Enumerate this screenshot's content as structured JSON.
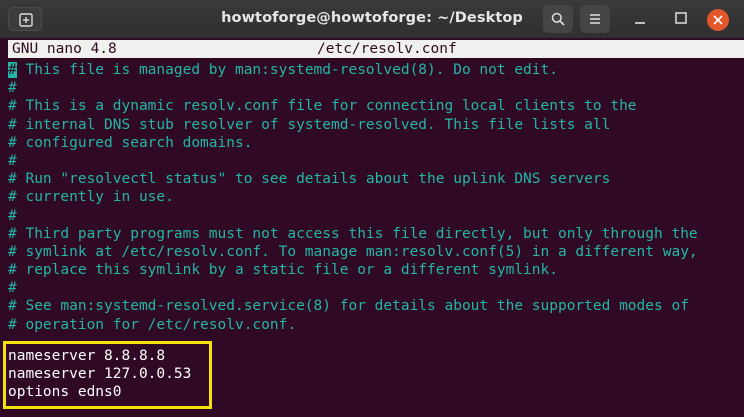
{
  "window": {
    "title": "howtoforge@howtoforge: ~/Desktop"
  },
  "icons": {
    "new_tab": "new-tab-icon",
    "search": "search-icon",
    "menu": "hamburger-menu-icon",
    "minimize": "minimize-icon",
    "maximize": "maximize-icon",
    "close": "close-icon"
  },
  "nano": {
    "version": "GNU nano 4.8",
    "filename": "/etc/resolv.conf"
  },
  "comment_lines": [
    "# This file is managed by man:systemd-resolved(8). Do not edit.",
    "#",
    "# This is a dynamic resolv.conf file for connecting local clients to the",
    "# internal DNS stub resolver of systemd-resolved. This file lists all",
    "# configured search domains.",
    "#",
    "# Run \"resolvectl status\" to see details about the uplink DNS servers",
    "# currently in use.",
    "#",
    "# Third party programs must not access this file directly, but only through the",
    "# symlink at /etc/resolv.conf. To manage man:resolv.conf(5) in a different way,",
    "# replace this symlink by a static file or a different symlink.",
    "#",
    "# See man:systemd-resolved.service(8) for details about the supported modes of",
    "# operation for /etc/resolv.conf."
  ],
  "config_lines": [
    "nameserver 8.8.8.8",
    "nameserver 127.0.0.53",
    "options edns0"
  ],
  "colors": {
    "terminal_bg": "#300a24",
    "comment": "#23b6a8",
    "highlight_box": "#f4e20a",
    "close_button": "#e2582c"
  }
}
